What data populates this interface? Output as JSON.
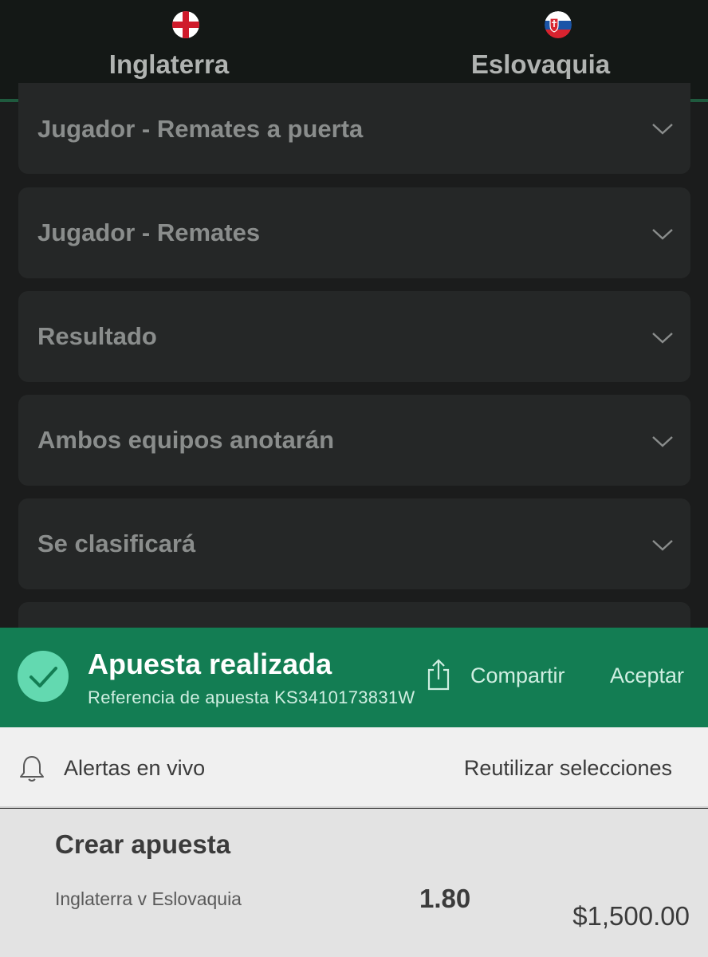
{
  "header": {
    "home_team": "Inglaterra",
    "away_team": "Eslovaquia",
    "home_flag_icon": "england-flag-icon",
    "away_flag_icon": "slovakia-flag-icon"
  },
  "markets": [
    {
      "label": "Jugador - Remates a puerta"
    },
    {
      "label": "Jugador - Remates"
    },
    {
      "label": "Resultado"
    },
    {
      "label": "Ambos equipos anotarán"
    },
    {
      "label": "Se clasificará"
    }
  ],
  "banner": {
    "title": "Apuesta realizada",
    "reference": "Referencia de apuesta KS3410173831W",
    "share_label": "Compartir",
    "accept_label": "Aceptar",
    "color": "#137d53"
  },
  "alerts": {
    "label": "Alertas en vivo",
    "reuse_label": "Reutilizar selecciones"
  },
  "bet": {
    "title": "Crear apuesta",
    "event": "Inglaterra v Eslovaquia",
    "odds": "1.80",
    "stake": "$1,500.00"
  }
}
